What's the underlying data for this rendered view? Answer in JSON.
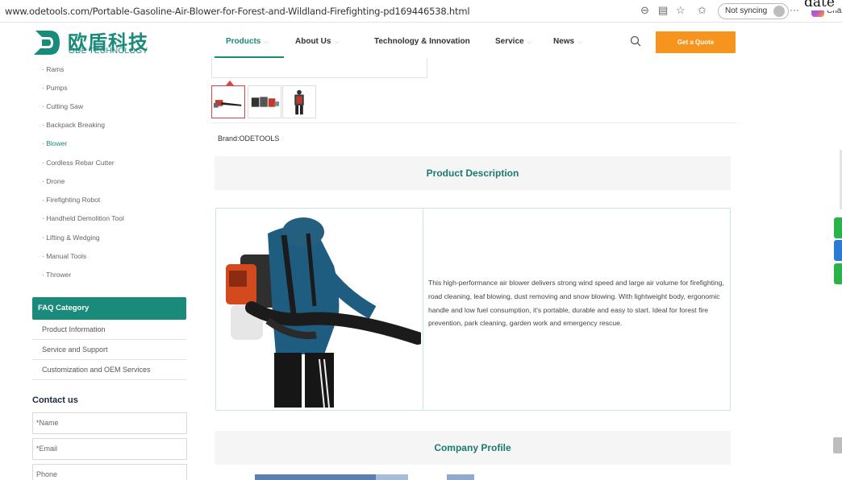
{
  "browser": {
    "url": "www.odetools.com/Portable-Gasoline-Air-Blower-for-Forest-and-Wildland-Firefighting-pd169446538.html",
    "sync_label": "Not syncing",
    "profile_label": "Cha",
    "overlay_text": "date"
  },
  "logo": {
    "cn": "欧盾科技",
    "en": "ODE TECHNOLOGY"
  },
  "nav": {
    "products": "Products",
    "about": "About Us",
    "tech": "Technology & Innovation",
    "service": "Service",
    "news": "News",
    "quote": "Get a Quote"
  },
  "sidebar": {
    "categories": [
      {
        "label": "· Rams"
      },
      {
        "label": "· Pumps"
      },
      {
        "label": "· Cutting Saw"
      },
      {
        "label": "· Backpack Breaking"
      },
      {
        "label": "· Blower"
      },
      {
        "label": "· Cordless Rebar Cutter"
      },
      {
        "label": "· Drone"
      },
      {
        "label": "· Firefighting Robot"
      },
      {
        "label": "· Handheld Demolition Tool"
      },
      {
        "label": "· Lifting & Wedging"
      },
      {
        "label": "· Manual Tools"
      },
      {
        "label": "· Thrower"
      }
    ],
    "active_category": "Blower",
    "faq_title": "FAQ Category",
    "faq_items": [
      {
        "label": "Product Information"
      },
      {
        "label": "Service and Support"
      },
      {
        "label": "Customization and OEM Services"
      }
    ],
    "contact_title": "Contact us",
    "contact_fields": {
      "name": "*Name",
      "email": "*Email",
      "phone": "Phone"
    }
  },
  "main": {
    "brand": "Brand:ODETOOLS",
    "product_description_title": "Product Description",
    "description": "This high-performance air blower delivers strong wind speed and large air volume for firefighting, road cleaning, leaf blowing, dust removing and snow blowing. With lightweight body, ergonomic handle and low fuel consumption, it's portable, durable and easy to start. Ideal for forest fire prevention, park cleaning, garden work and emergency rescue.",
    "company_profile_title": "Company Profile"
  },
  "colors": {
    "brand_teal": "#1a8a7a",
    "quote_orange": "#f7941d"
  }
}
